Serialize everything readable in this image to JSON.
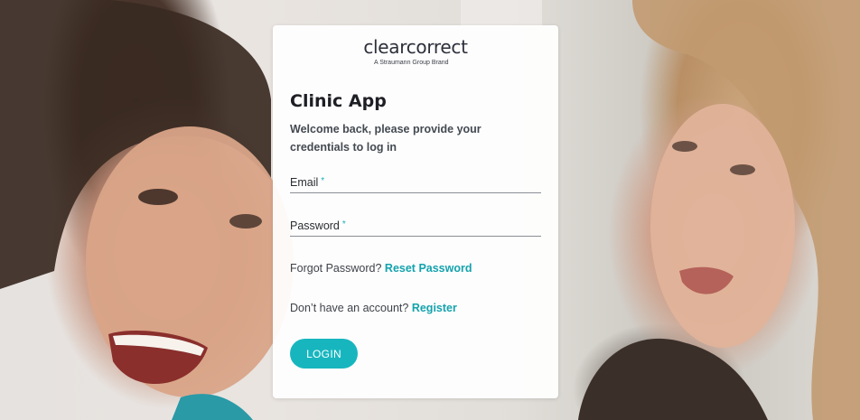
{
  "brand": {
    "logo_text": "clearcorrect",
    "logo_tagline": "A Straumann Group Brand"
  },
  "login": {
    "title": "Clinic App",
    "welcome": "Welcome back, please provide your credentials to log in",
    "email_label": "Email",
    "password_label": "Password",
    "required_marker": "*",
    "forgot_prompt": "Forgot Password?",
    "reset_link": "Reset Password",
    "register_prompt": "Don’t have an account?",
    "register_link": "Register",
    "login_button": "LOGIN"
  },
  "colors": {
    "accent": "#17b6bf",
    "link": "#14a3ad",
    "title": "#1d1f24"
  }
}
